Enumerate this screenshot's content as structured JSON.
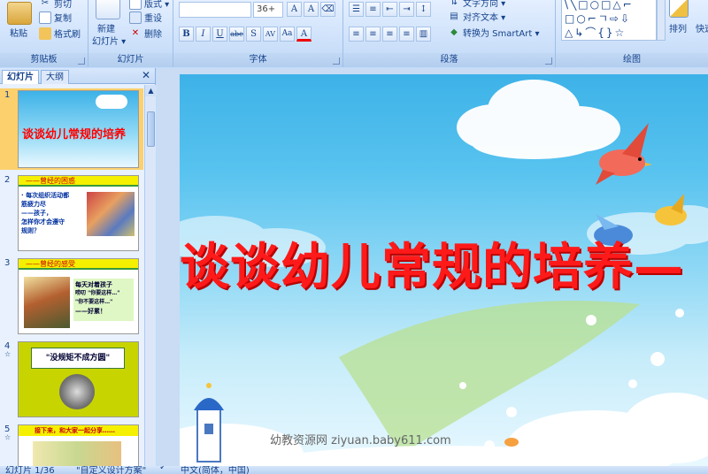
{
  "ribbon": {
    "clipboard": {
      "label": "剪贴板",
      "paste": "粘贴",
      "cut": "剪切",
      "copy": "复制",
      "format_painter": "格式刷"
    },
    "slides": {
      "label": "幻灯片",
      "new_slide": "新建",
      "new_slide_2": "幻灯片 ▾",
      "layout": "版式 ▾",
      "reset": "重设",
      "delete": "删除"
    },
    "font": {
      "label": "字体",
      "font_size": "36+",
      "buttons": [
        "B",
        "I",
        "U",
        "abe",
        "S",
        "AV",
        "Aa",
        "A"
      ]
    },
    "paragraph": {
      "label": "段落",
      "text_direction": "文字方向 ▾",
      "align_text": "对齐文本 ▾",
      "smartart": "转换为 SmartArt ▾"
    },
    "drawing": {
      "label": "绘图",
      "arrange": "排列",
      "quick_styles": "快速"
    }
  },
  "pane": {
    "tab_slides": "幻灯片",
    "tab_outline": "大纲",
    "close": "✕"
  },
  "slides": [
    {
      "num": "1",
      "title": "谈谈幼儿常规的培养"
    },
    {
      "num": "2",
      "header": "——曾经的困惑",
      "lines": [
        "· 每次组织活动都",
        "  筋疲力尽",
        "  ——孩子，",
        "  怎样你才会遵守",
        "  规则？"
      ]
    },
    {
      "num": "3",
      "header": "——曾经的感受",
      "lines": [
        "每天对着孩子",
        "唠叨 \"你要这样…\"",
        "\"你不要这样…\"",
        "——好累！"
      ]
    },
    {
      "num": "4",
      "sub": "☆",
      "title": "\"没规矩不成方圆\""
    },
    {
      "num": "5",
      "sub": "☆",
      "header": "接下来，和大家一起分享……"
    }
  ],
  "main_slide": {
    "title": "谈谈幼儿常规的培养—",
    "watermark": "幼教资源网 ziyuan.baby611.com"
  },
  "status": {
    "slide_count": "幻灯片 1/36",
    "theme": "\"自定义设计方案\"",
    "language": "中文(简体，中国)"
  },
  "colors": {
    "title_red": "#ff1a1a",
    "sky": "#3db2e8",
    "ribbon": "#cfe2fb",
    "selection": "#fbd06d"
  }
}
